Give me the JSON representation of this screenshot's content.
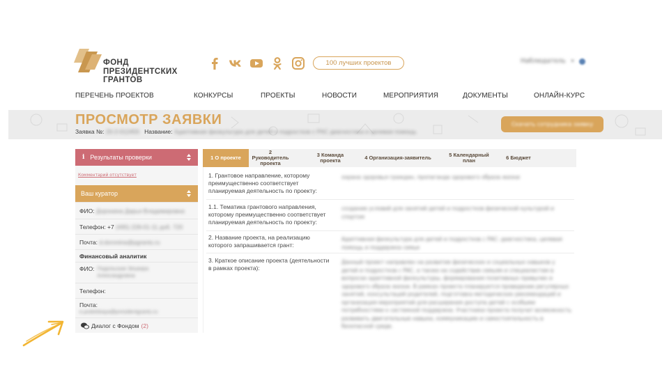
{
  "header": {
    "logo_lines": [
      "ФОНД",
      "ПРЕЗИДЕНТСКИХ",
      "ГРАНТОВ"
    ],
    "social_icons": [
      "facebook-icon",
      "vk-icon",
      "youtube-icon",
      "odnoklassniki-icon",
      "instagram-icon"
    ],
    "top_link": "100 лучших проектов",
    "account_name": "Наблюдатель",
    "account_close": "×"
  },
  "nav": {
    "items": [
      "ПЕРЕЧЕНЬ ПРОЕКТОВ",
      "КОНКУРСЫ",
      "ПРОЕКТЫ",
      "НОВОСТИ",
      "МЕРОПРИЯТИЯ",
      "ДОКУМЕНТЫ",
      "ОНЛАЙН-КУРС"
    ]
  },
  "banner": {
    "title": "ПРОСМОТР ЗАЯВКИ",
    "request_label": "Заявка №:",
    "request_number": "20-2-012455",
    "name_label": "Название:",
    "name_value": "Адаптивная физкультура для детей и подростков с РАС диагностика и целевая помощь",
    "button_label": "Скачать сотрудника заявку"
  },
  "sidebar": {
    "check_label": "Результаты проверки",
    "check_icon": "i",
    "comment": "Комментарий отсутствует",
    "curator_label": "Ваш куратор",
    "fio_label": "ФИО:",
    "fio_value": "Доронина Дарья Владимировна",
    "phone_label": "Телефон: +7",
    "phone_value": "(495) 228-01-11 доб. 720",
    "mail_label": "Почта:",
    "mail_value": "d.doronina@pgrants.ru",
    "analyst_label": "Финансовый аналитик",
    "fio2_label": "ФИО:",
    "fio2_value": "Подольская Эльвира Александровна",
    "phone2_label": "Телефон:",
    "mail2_label": "Почта:",
    "mail2_value": "e.podolskaya@presidentgrants.ru",
    "dialog_label": "Диалог с Фондом",
    "dialog_count": "(2)"
  },
  "tabs": [
    {
      "label": "1 О проекте",
      "active": true
    },
    {
      "label": "2 Руководитель проекта",
      "active": false
    },
    {
      "label": "3 Команда проекта",
      "active": false
    },
    {
      "label": "4 Организация-заявитель",
      "active": false
    },
    {
      "label": "5 Календарный план",
      "active": false
    },
    {
      "label": "6 Бюджет",
      "active": false
    }
  ],
  "form": {
    "rows": [
      {
        "question": "1. Грантовое направление, которому преимущественно соответствует планируемая деятельность по проекту:",
        "answer": "охрана здоровья граждан, пропаганда здорового образа жизни"
      },
      {
        "question": "1.1. Тематика грантового направления, которому преимущественно соответствует планируемая деятельность по проекту:",
        "answer": "создание условий для занятий детей и подростков физической культурой и спортом"
      },
      {
        "question": "2. Название проекта, на реализацию которого запрашивается грант:",
        "answer": "Адаптивная физкультура для детей и подростков с РАС: диагностика, целевая помощь и поддержка семьи"
      },
      {
        "question": "3. Краткое описание проекта (деятельности в рамках проекта):",
        "answer": "Данный проект направлен на развитие физических и социальных навыков у детей и подростков с РАС, а также на содействие семьям и специалистам в вопросах адаптивной физкультуры, формирования позитивных привычек и здорового образа жизни. В рамках проекта планируется проведение регулярных занятий, консультаций родителей, подготовка методических рекомендаций и организация мероприятий для расширения доступа детей с особыми потребностями к системной поддержке. Участники проекта получат возможность развивать двигательные навыки, коммуникацию и самостоятельность в безопасной среде."
      }
    ]
  },
  "colors": {
    "gold": "#d9a55b",
    "rose": "#cd6b74",
    "banner_bg": "#ececec",
    "arrow": "#f2b532"
  }
}
